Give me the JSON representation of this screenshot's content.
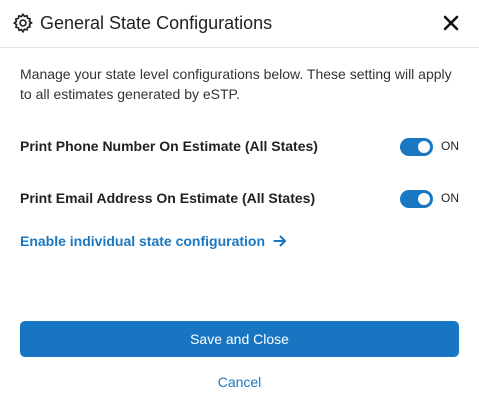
{
  "dialog": {
    "title": "General State Configurations",
    "description": "Manage your state level configurations below. These setting will apply to all estimates generated by eSTP."
  },
  "settings": [
    {
      "label": "Print Phone Number On Estimate (All States)",
      "state": "ON",
      "enabled": true
    },
    {
      "label": "Print Email Address On Estimate (All States)",
      "state": "ON",
      "enabled": true
    }
  ],
  "link": {
    "label": "Enable individual state configuration"
  },
  "actions": {
    "save_label": "Save and Close",
    "cancel_label": "Cancel"
  },
  "icons": {
    "header": "gear-icon",
    "close": "close-icon",
    "link": "arrow-right-icon"
  },
  "colors": {
    "accent": "#1a78c2",
    "primary_button": "#1775c2"
  }
}
